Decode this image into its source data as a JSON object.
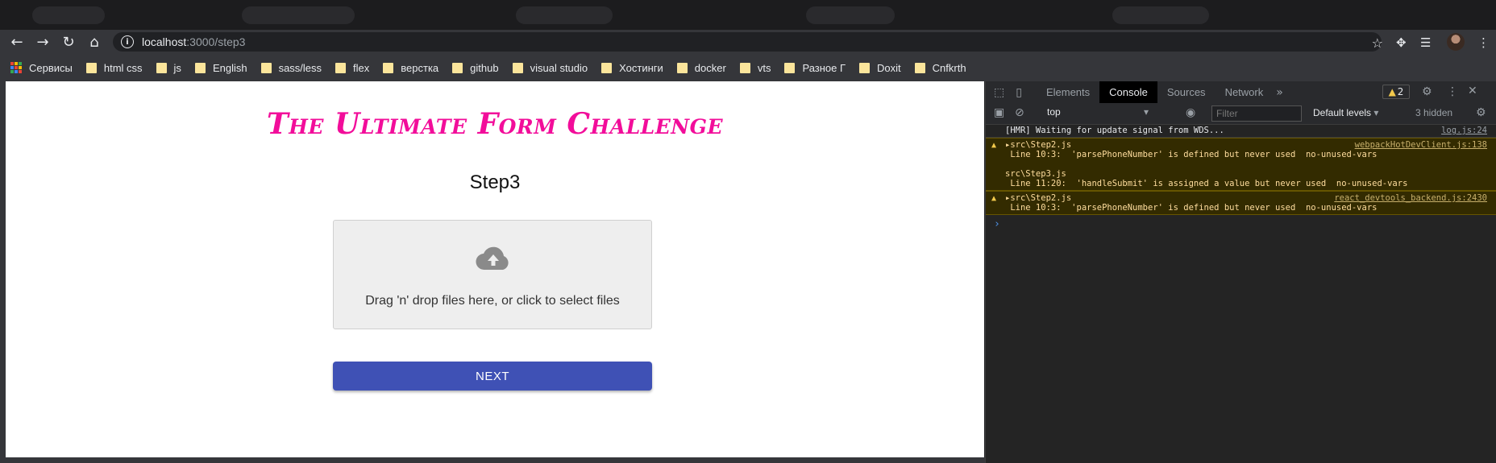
{
  "browser": {
    "url_host": "localhost",
    "url_path": ":3000/step3",
    "bookmarks": [
      {
        "label": "Сервисы",
        "type": "apps"
      },
      {
        "label": "html css",
        "type": "folder"
      },
      {
        "label": "js",
        "type": "folder"
      },
      {
        "label": "English",
        "type": "folder"
      },
      {
        "label": "sass/less",
        "type": "folder"
      },
      {
        "label": "flex",
        "type": "folder"
      },
      {
        "label": "верстка",
        "type": "folder"
      },
      {
        "label": "github",
        "type": "folder"
      },
      {
        "label": "visual studio",
        "type": "folder"
      },
      {
        "label": "Хостинги",
        "type": "folder"
      },
      {
        "label": "docker",
        "type": "folder"
      },
      {
        "label": "vts",
        "type": "folder"
      },
      {
        "label": "Разное Г",
        "type": "folder"
      },
      {
        "label": "Doxit",
        "type": "folder"
      },
      {
        "label": "Cnfkrth",
        "type": "folder"
      }
    ]
  },
  "page": {
    "title": "The Ultimate Form Challenge",
    "step_title": "Step3",
    "dropzone_text": "Drag 'n' drop files here, or click to select files",
    "next_label": "NEXT",
    "title_color": "#f20d9a",
    "button_color": "#3f51b5"
  },
  "devtools": {
    "tabs": [
      "Elements",
      "Console",
      "Sources",
      "Network"
    ],
    "active_tab": "Console",
    "warning_count": "2",
    "context": "top",
    "filter_placeholder": "Filter",
    "levels": "Default levels",
    "hidden": "3 hidden",
    "messages": [
      {
        "type": "log",
        "text": "[HMR] Waiting for update signal from WDS...",
        "source": "log.js:24"
      },
      {
        "type": "warn",
        "text": "▸src\\Step2.js\n Line 10:3:  'parsePhoneNumber' is defined but never used  no-unused-vars\n\nsrc\\Step3.js\n Line 11:20:  'handleSubmit' is assigned a value but never used  no-unused-vars",
        "source": "webpackHotDevClient.js:138"
      },
      {
        "type": "warn",
        "text": "▸src\\Step2.js\n Line 10:3:  'parsePhoneNumber' is defined but never used  no-unused-vars",
        "source": "react_devtools_backend.js:2430"
      }
    ]
  }
}
